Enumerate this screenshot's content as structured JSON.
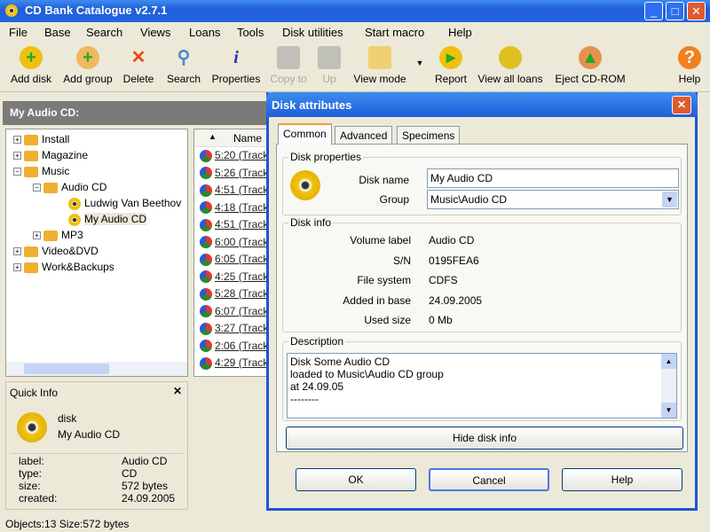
{
  "window": {
    "title": "CD Bank Catalogue v2.7.1"
  },
  "menu": [
    "File",
    "Base",
    "Search",
    "Views",
    "Loans",
    "Tools",
    "Disk utilities",
    "Start macro",
    "Help"
  ],
  "toolbar": [
    {
      "label": "Add disk",
      "icon": "add-disk-icon",
      "enabled": true
    },
    {
      "label": "Add group",
      "icon": "add-group-icon",
      "enabled": true
    },
    {
      "label": "Delete",
      "icon": "delete-icon",
      "enabled": true
    },
    {
      "label": "Search",
      "icon": "search-icon",
      "enabled": true
    },
    {
      "label": "Properties",
      "icon": "info-icon",
      "enabled": true
    },
    {
      "label": "Copy to",
      "icon": "copy-icon",
      "enabled": false
    },
    {
      "label": "Up",
      "icon": "folder-up-icon",
      "enabled": false
    },
    {
      "label": "View mode",
      "icon": "view-mode-icon",
      "enabled": true
    },
    {
      "label": "Report",
      "icon": "report-icon",
      "enabled": true
    },
    {
      "label": "View all loans",
      "icon": "loans-icon",
      "enabled": true
    },
    {
      "label": "Eject CD-ROM",
      "icon": "eject-icon",
      "enabled": true
    },
    {
      "label": "Help",
      "icon": "help-icon",
      "enabled": true
    }
  ],
  "panel_header": "My Audio CD:",
  "tree": {
    "install": "Install",
    "magazine": "Magazine",
    "music": "Music",
    "audio_cd": "Audio CD",
    "beethoven": "Ludwig Van Beethov",
    "my_audio_cd": "My Audio CD",
    "mp3": "MP3",
    "video": "Video&DVD",
    "work": "Work&Backups"
  },
  "list": {
    "header": "Name",
    "items": [
      "5:20 (Track",
      "5:26 (Track",
      "4:51 (Track",
      "4:18 (Track",
      "4:51 (Track",
      "6:00 (Track",
      "6:05 (Track",
      "4:25 (Track",
      "5:28 (Track",
      "6:07 (Track",
      "3:27 (Track",
      "2:06 (Track",
      "4:29 (Track"
    ]
  },
  "quick_info": {
    "title": "Quick Info",
    "kind": "disk",
    "name": "My Audio CD",
    "rows": [
      {
        "k": "label:",
        "v": "Audio CD"
      },
      {
        "k": "type:",
        "v": "CD"
      },
      {
        "k": "size:",
        "v": "572 bytes"
      },
      {
        "k": "created:",
        "v": "24.09.2005"
      }
    ]
  },
  "status": "Objects:13 Size:572 bytes",
  "dialog": {
    "title": "Disk attributes",
    "tabs": [
      "Common",
      "Advanced",
      "Specimens"
    ],
    "props": {
      "title": "Disk properties",
      "name_label": "Disk name",
      "name_value": "My Audio CD",
      "group_label": "Group",
      "group_value": "Music\\Audio CD"
    },
    "info": {
      "title": "Disk info",
      "rows": [
        {
          "k": "Volume label",
          "v": "Audio CD"
        },
        {
          "k": "S/N",
          "v": "0195FEA6"
        },
        {
          "k": "File system",
          "v": "CDFS"
        },
        {
          "k": "Added in base",
          "v": "24.09.2005"
        },
        {
          "k": "Used size",
          "v": "0 Mb"
        }
      ]
    },
    "description": {
      "title": "Description",
      "lines": [
        "Disk Some Audio CD",
        "loaded to Music\\Audio CD group",
        "at 24.09.05",
        "--------"
      ]
    },
    "hide_button": "Hide disk info",
    "ok": "OK",
    "cancel": "Cancel",
    "help": "Help"
  }
}
